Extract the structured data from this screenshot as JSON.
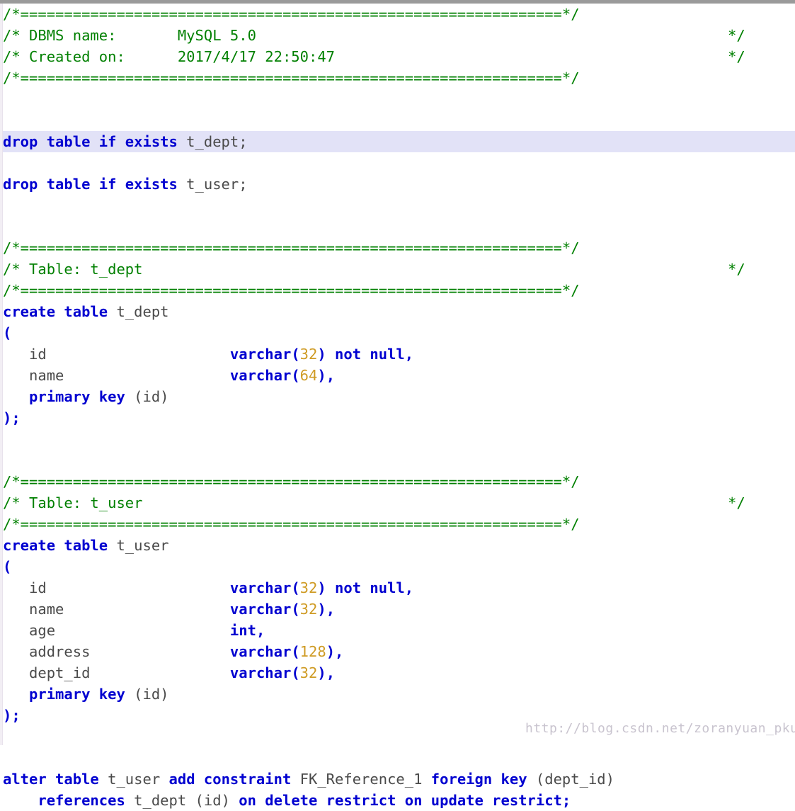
{
  "editor": {
    "language": "sql",
    "current_line_index": 6,
    "colors": {
      "comment": "#008000",
      "keyword": "#0000d0",
      "identifier": "#4a4a4a",
      "number": "#cf9b24",
      "current_line_highlight": "#e2e2f7",
      "background": "#ffffff",
      "top_bar": "#9a9a9a",
      "left_margin": "#f2eef4"
    }
  },
  "header": {
    "dbms_label": "/* DBMS name:",
    "dbms_value": "MySQL 5.0",
    "created_label": "/* Created on:",
    "created_value": "2017/4/17 22:50:47",
    "rule": "/*==============================================================*/",
    "rule_end": "*/"
  },
  "watermark": {
    "text": "http://blog.csdn.net/zoranyuan_pku"
  },
  "code": {
    "comment_rule": "/*==============================================================*/",
    "comment_close": "*/",
    "dbms_name_line": "/* DBMS name:       MySQL 5.0",
    "created_on_line": "/* Created on:      2017/4/17 22:50:47",
    "table_dept_comment": "/* Table: t_dept",
    "table_user_comment": "/* Table: t_user",
    "drop_dept": {
      "kw1": "drop table if exists",
      "name": " t_dept;"
    },
    "drop_user": {
      "kw1": "drop table if exists",
      "name": " t_user;"
    },
    "create_dept": {
      "kw": "create table",
      "name": " t_dept"
    },
    "create_user": {
      "kw": "create table",
      "name": " t_user"
    },
    "open_paren": "(",
    "close_paren": ");",
    "dept_columns": [
      {
        "name": "id",
        "pad": "                     ",
        "type": "varchar",
        "lparen": "(",
        "size": "32",
        "rparen": ")",
        "constraint": " not null",
        "comma": ","
      },
      {
        "name": "name",
        "pad": "                   ",
        "type": "varchar",
        "lparen": "(",
        "size": "64",
        "rparen": ")",
        "constraint": "",
        "comma": ","
      }
    ],
    "user_columns": [
      {
        "name": "id",
        "pad": "                     ",
        "type": "varchar",
        "lparen": "(",
        "size": "32",
        "rparen": ")",
        "constraint": " not null",
        "comma": ","
      },
      {
        "name": "name",
        "pad": "                   ",
        "type": "varchar",
        "lparen": "(",
        "size": "32",
        "rparen": ")",
        "constraint": "",
        "comma": ","
      },
      {
        "name": "age",
        "pad": "                    ",
        "type": "int",
        "lparen": "",
        "size": "",
        "rparen": "",
        "constraint": "",
        "comma": ","
      },
      {
        "name": "address",
        "pad": "                ",
        "type": "varchar",
        "lparen": "(",
        "size": "128",
        "rparen": ")",
        "constraint": "",
        "comma": ","
      },
      {
        "name": "dept_id",
        "pad": "                ",
        "type": "varchar",
        "lparen": "(",
        "size": "32",
        "rparen": ")",
        "constraint": "",
        "comma": ","
      }
    ],
    "primary_key": {
      "kw": "primary key",
      "cols": " (id)"
    },
    "alter_line1": {
      "kw1": "alter table",
      "tbl": " t_user ",
      "kw2": "add constraint",
      "fkname": " FK_Reference_1 ",
      "kw3": "foreign key",
      "cols": " (dept_id)"
    },
    "alter_line2": {
      "kw1": "references",
      "tbl": " t_dept ",
      "cols": "(id) ",
      "kw2": "on delete restrict on update restrict",
      "semi": ";"
    }
  }
}
